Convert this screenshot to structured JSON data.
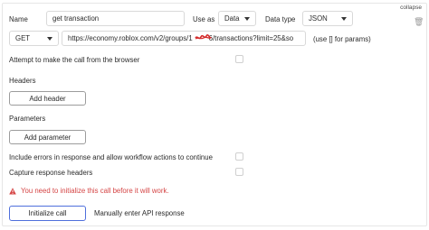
{
  "header": {
    "collapse_label": "collapse"
  },
  "row1": {
    "name_label": "Name",
    "name_value": "get transaction",
    "use_as_label": "Use as",
    "use_as_value": "Data",
    "data_type_label": "Data type",
    "data_type_value": "JSON"
  },
  "row2": {
    "method_value": "GET",
    "url_prefix": "https://economy.roblox.com/v2/groups/1",
    "url_suffix": "6/transactions?limit=25&so",
    "params_hint": "(use [] for params)"
  },
  "options": {
    "browser_call_label": "Attempt to make the call from the browser",
    "headers_label": "Headers",
    "add_header_label": "Add header",
    "parameters_label": "Parameters",
    "add_parameter_label": "Add parameter",
    "include_errors_label": "Include errors in response and allow workflow actions to continue",
    "capture_headers_label": "Capture response headers"
  },
  "warning": {
    "text": "You need to initialize this call before it will work."
  },
  "actions": {
    "initialize_label": "Initialize call",
    "manual_label": "Manually enter API response"
  },
  "colors": {
    "warning": "#d54545",
    "accent": "#4f6fdc",
    "border": "#d9d9d9"
  }
}
